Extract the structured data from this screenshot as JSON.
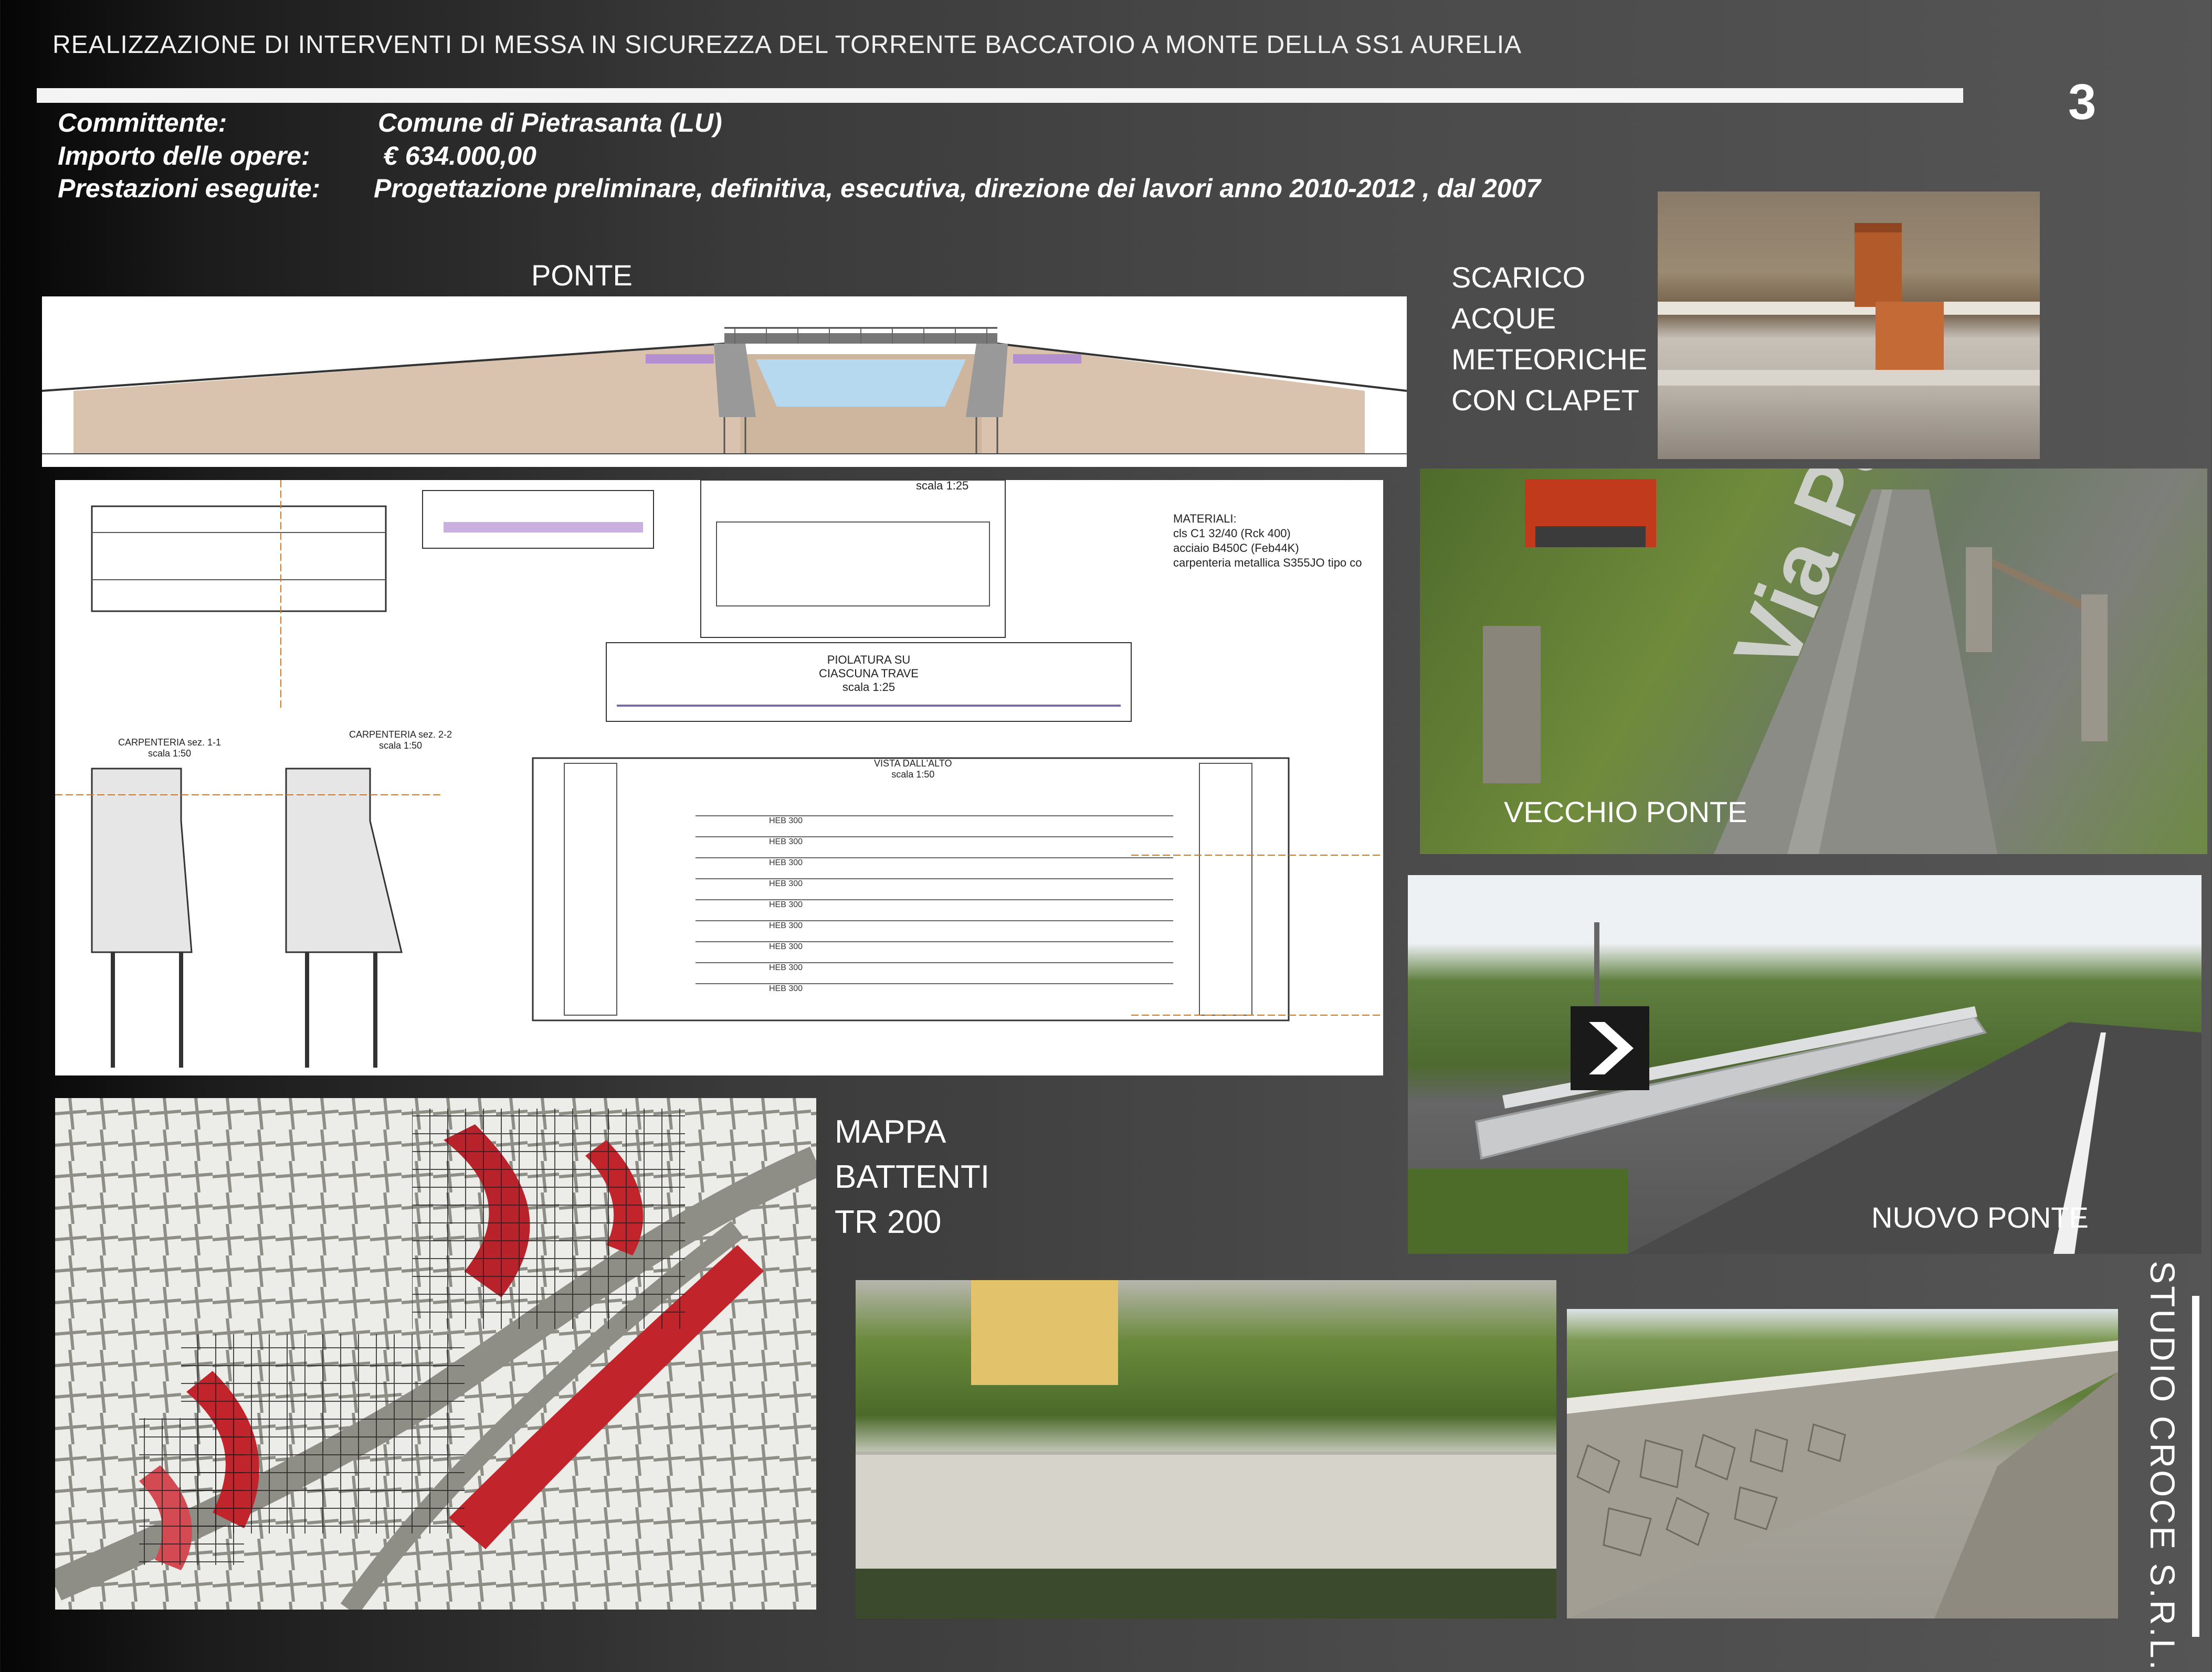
{
  "header": {
    "title": "REALIZZAZIONE DI INTERVENTI DI MESSA IN SICUREZZA DEL TORRENTE BACCATOIO A MONTE DELLA SS1 AURELIA",
    "page_number": "3"
  },
  "info": {
    "committente_label": "Committente:",
    "committente_value": "Comune di Pietrasanta (LU)",
    "importo_label": "Importo delle opere:",
    "importo_value": "€ 634.000,00",
    "prestazioni_label": "Prestazioni eseguite:",
    "prestazioni_value": "Progettazione  preliminare, definitiva, esecutiva, direzione dei lavori anno 2010-2012 , dal 2007"
  },
  "sections": {
    "ponte": "PONTE",
    "scarico_1": "SCARICO",
    "scarico_2": "ACQUE",
    "scarico_3": "METEORICHE",
    "scarico_4": "CON CLAPET",
    "vecchio_ponte": "VECCHIO PONTE",
    "nuovo_ponte": "NUOVO PONTE",
    "mappa_1": "MAPPA",
    "mappa_2": "BATTENTI",
    "mappa_3": "TR 200"
  },
  "drawing": {
    "scala_1": "scala 1:25",
    "materiali_title": "MATERIALI:",
    "materiali_1": "cls C1 32/40 (Rck 400)",
    "materiali_2": "acciaio B450C (Feb44K)",
    "materiali_3": "carpenteria metallica S355JO tipo co",
    "pilatura_title": "PIOLATURA SU CIASCUNA TRAVE",
    "pilatura_scale": "scala 1:25",
    "carpenteria_1": "CARPENTERIA sez. 1-1",
    "carpenteria_2": "CARPENTERIA sez. 2-2",
    "carp_scale": "scala 1:50",
    "vista_title": "VISTA DALL'ALTO",
    "vista_scale": "scala 1:50",
    "heb_label": "HEB 300",
    "sign_text": "Via Padule"
  },
  "footer": {
    "studio": "STUDIO CROCE S.R.L."
  }
}
